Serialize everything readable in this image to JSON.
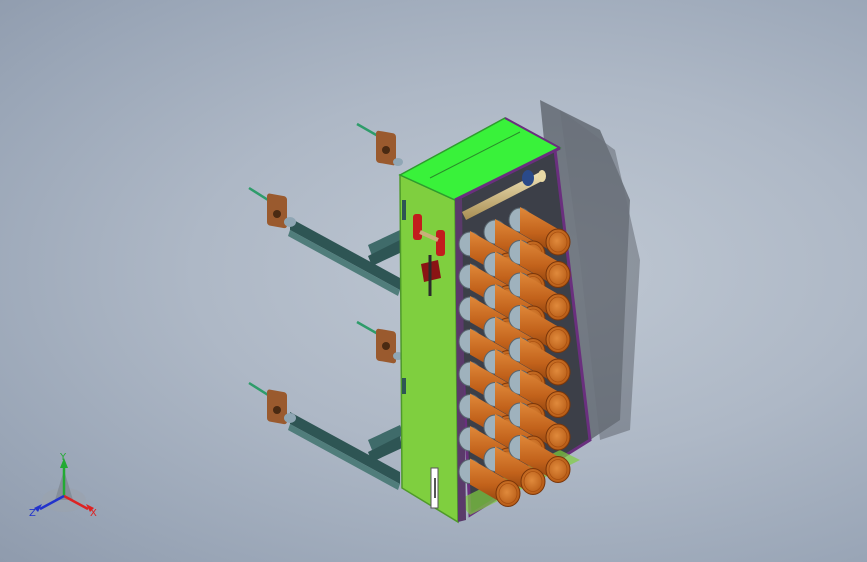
{
  "viewport": {
    "background_top": "#c3ccd7",
    "background_bottom": "#8f9bad"
  },
  "colors": {
    "frame_green": "#7fcf3f",
    "frame_green_top": "#39f23a",
    "frame_green_dark": "#4f9a2a",
    "purple_edge": "#6a2f7e",
    "roll_orange": "#c8661a",
    "roll_orange_light": "#dd7f2c",
    "roll_orange_dark": "#8f430d",
    "bracket_copper": "#9a5a2e",
    "rail_teal": "#3f6b6a",
    "handle_red": "#c21d1d",
    "shaft_tan": "#c9b07a"
  },
  "triad": {
    "y_label": "Y",
    "x_label": "X",
    "z_label": "Z",
    "y_color": "#22aa33",
    "x_color": "#dd2222",
    "z_color": "#2233cc"
  }
}
